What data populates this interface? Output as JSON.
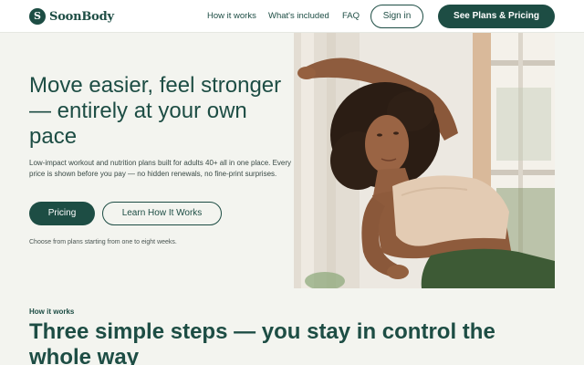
{
  "brand": {
    "logo_letter": "S",
    "name": "SoonBody"
  },
  "nav": {
    "how_it_works": "How it works",
    "whats_included": "What's included",
    "faq": "FAQ",
    "sign_in": "Sign in",
    "cta": "See Plans & Pricing"
  },
  "hero": {
    "title": "Move easier, feel stronger — entirely at your own pace",
    "subtitle": "Low-impact workout and nutrition plans built for adults 40+ all in one place. Every price is shown before you pay — no hidden renewals, no fine-print surprises.",
    "primary_button": "Pricing",
    "secondary_button": "Learn How It Works",
    "note": "Choose from plans starting from one to eight weeks."
  },
  "steps": {
    "eyebrow": "How it works",
    "title": "Three simple steps — you stay in control the whole way"
  },
  "colors": {
    "brand_green": "#1d4d44",
    "page_bg": "#f3f4ef",
    "header_bg": "#ffffff"
  },
  "icons": {
    "logo": "brand-monogram-icon"
  }
}
